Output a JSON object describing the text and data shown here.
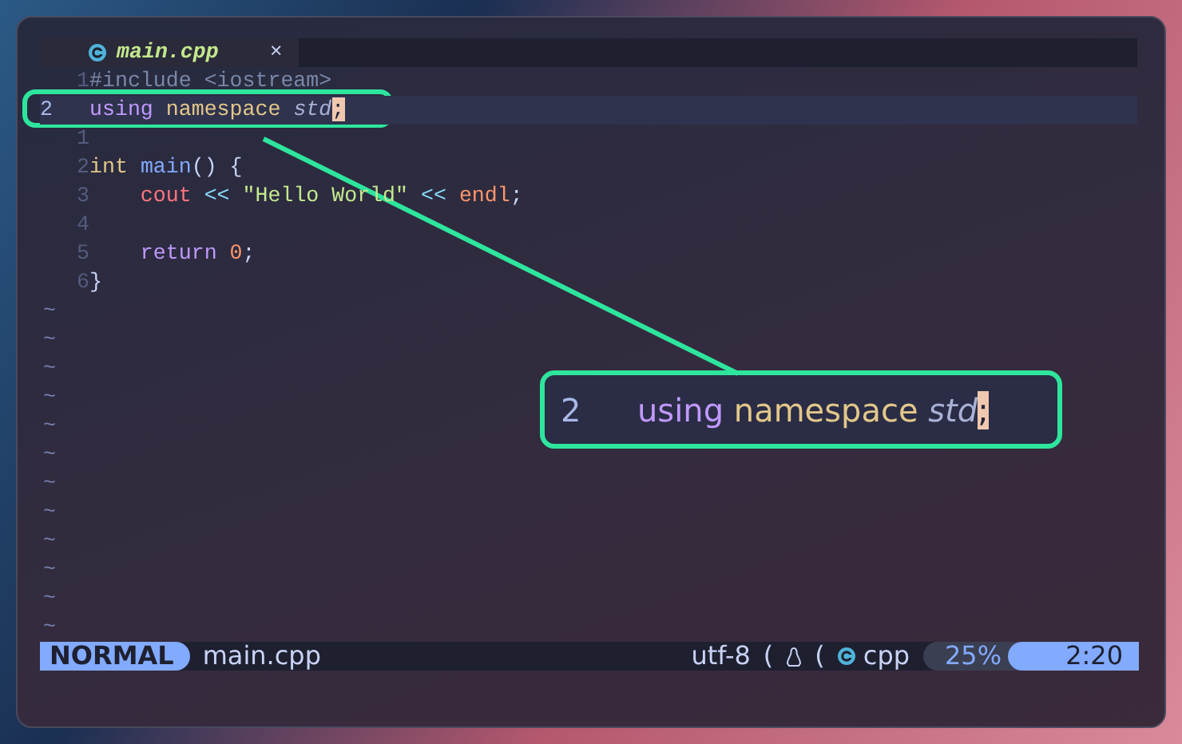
{
  "tab": {
    "title": "main.cpp",
    "close": "×"
  },
  "lines": [
    {
      "number": "1",
      "current": false,
      "tokens": [
        {
          "text": "#include <iostream>",
          "kind": "preproc"
        }
      ]
    },
    {
      "number": "2",
      "current": true,
      "tokens": [
        {
          "text": "using",
          "kind": "keyword"
        },
        {
          "text": " namespace",
          "kind": "type"
        },
        {
          "text": " std",
          "kind": "namespace"
        },
        {
          "text": ";",
          "kind": "cursor"
        }
      ]
    },
    {
      "number": "1",
      "current": false
    },
    {
      "number": "2",
      "current": false,
      "tokens": [
        {
          "text": "int",
          "kind": "type"
        },
        {
          "text": " main",
          "kind": "function"
        },
        {
          "text": "() {",
          "kind": "plain"
        }
      ]
    },
    {
      "number": "3",
      "current": false,
      "tokens": [
        {
          "text": "    cout",
          "kind": "variable"
        },
        {
          "text": " <<",
          "kind": "operator"
        },
        {
          "text": " \"Hello World\"",
          "kind": "string"
        },
        {
          "text": " <<",
          "kind": "operator"
        },
        {
          "text": " endl",
          "kind": "constant"
        },
        {
          "text": ";",
          "kind": "plain"
        }
      ]
    },
    {
      "number": "4",
      "current": false
    },
    {
      "number": "5",
      "current": false,
      "tokens": [
        {
          "text": "    return",
          "kind": "keyword"
        },
        {
          "text": " 0",
          "kind": "constant"
        },
        {
          "text": ";",
          "kind": "plain"
        }
      ]
    },
    {
      "number": "6",
      "current": false,
      "tokens": [
        {
          "text": "}",
          "kind": "plain"
        }
      ]
    }
  ],
  "empty_line_markers": [
    "~",
    "~",
    "~",
    "~",
    "~",
    "~",
    "~",
    "~",
    "~",
    "~",
    "~",
    "~"
  ],
  "callout": {
    "number": "2",
    "tokens": [
      {
        "text": "using",
        "kind": "keyword"
      },
      {
        "text": " namespace",
        "kind": "type"
      },
      {
        "text": " std",
        "kind": "namespace"
      },
      {
        "text": ";",
        "kind": "cursor"
      }
    ]
  },
  "status_bar": {
    "mode": "NORMAL",
    "file": "main.cpp",
    "encoding": "utf-8",
    "separators": [
      "(",
      "("
    ],
    "filetype": "cpp",
    "percent": "25%",
    "position": "2:20"
  }
}
